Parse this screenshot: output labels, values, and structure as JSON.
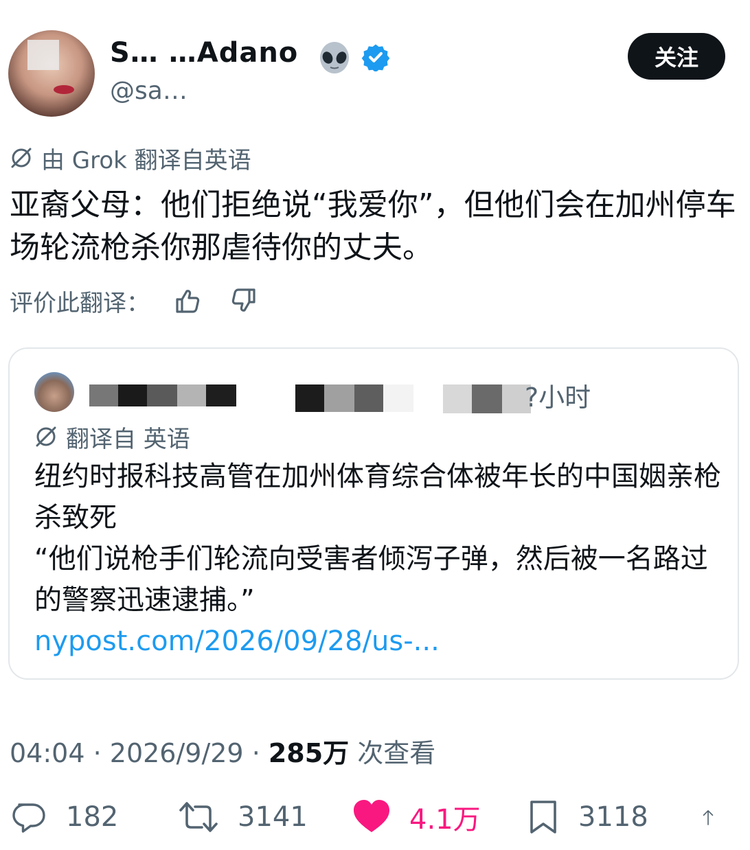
{
  "header": {
    "display_name": "S… …Adano",
    "handle": "@sa…",
    "follow_label": "关注",
    "verified_color": "#1d9bf0"
  },
  "post": {
    "translated_by": "由 Grok 翻译自英语",
    "text": "亚裔父母：他们拒绝说“我爱你”，但他们会在加州停车场轮流枪杀你那虐待你的丈夫。",
    "rate_label": "评价此翻译："
  },
  "quote": {
    "time": "?小时",
    "translated_from": "翻译自 英语",
    "line1": "纽约时报科技高管在加州体育综合体被年长的中国姻亲枪杀致死",
    "line2": "“他们说枪手们轮流向受害者倾泻子弹，然后被一名路过的警察迅速逮捕。”",
    "link": "nypost.com/2026/09/28/us-..."
  },
  "meta": {
    "time": "04:04",
    "date": "2026/9/29",
    "views_count": "285万",
    "views_label": "次查看",
    "sep": " · "
  },
  "actions": {
    "replies": "182",
    "retweets": "3141",
    "likes": "4.1万",
    "bookmarks": "3118",
    "like_color": "#f91880"
  }
}
